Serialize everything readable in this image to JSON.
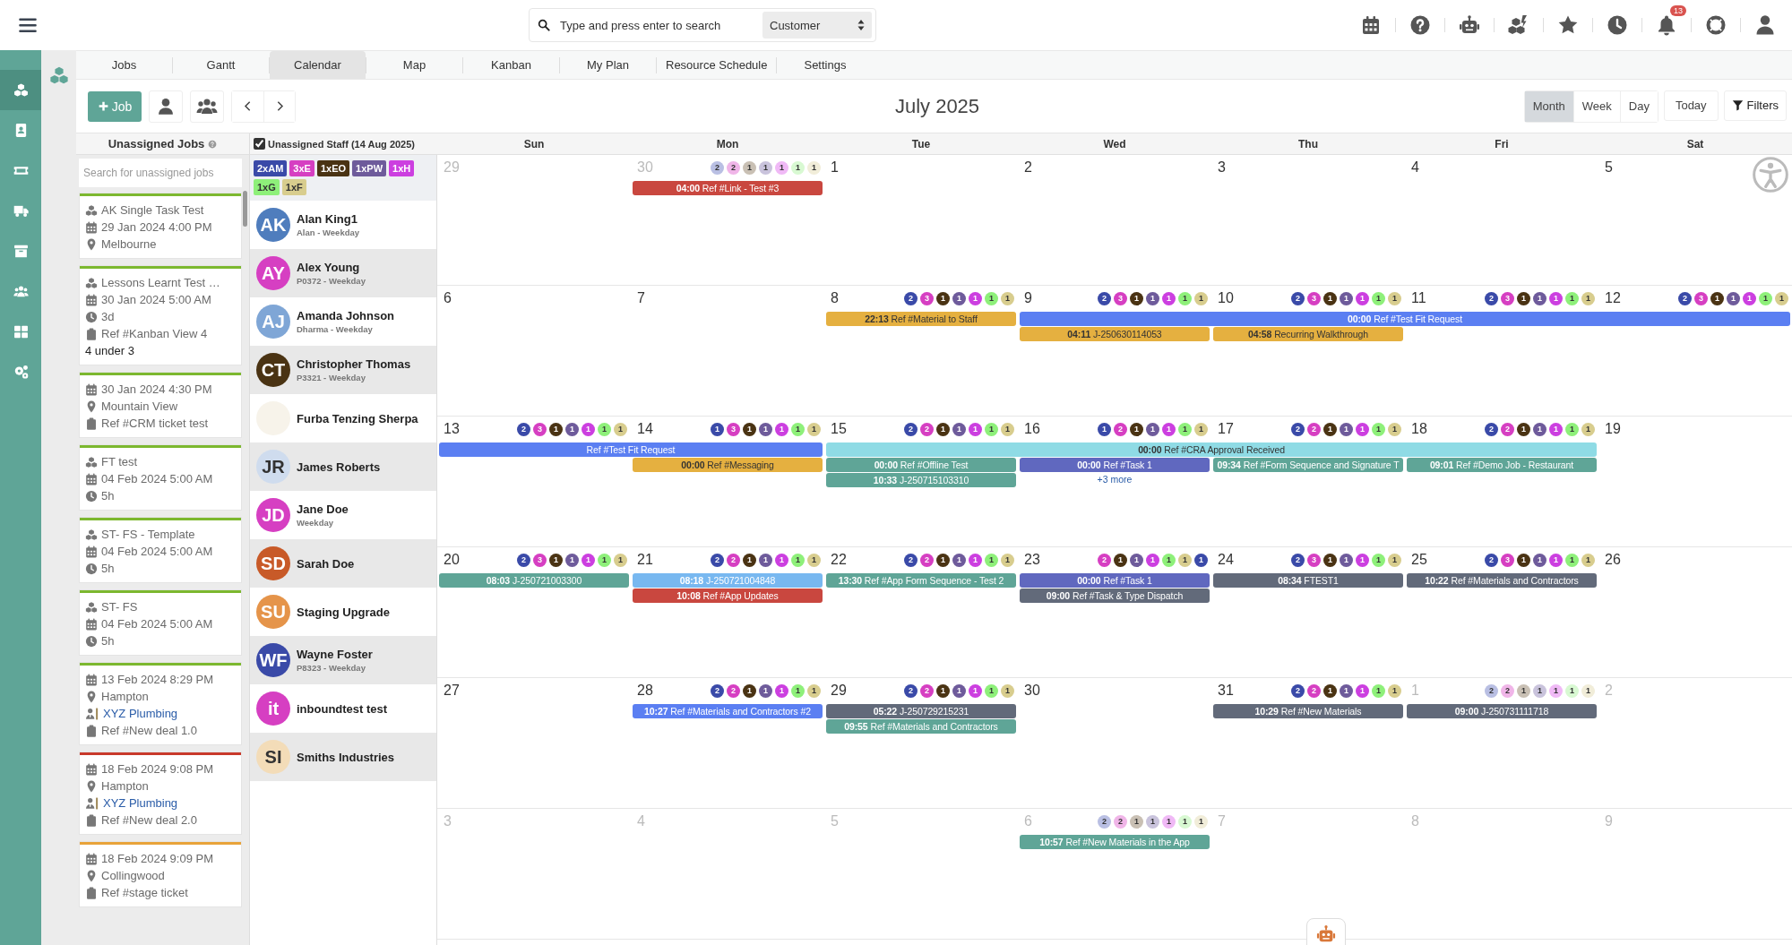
{
  "topbar": {
    "search": {
      "placeholder": "Type and press enter to search"
    },
    "search_scope": "Customer",
    "notification_count": "13"
  },
  "sidebar": [
    {
      "selected": true
    },
    {
      "selected": false
    },
    {
      "selected": false
    },
    {
      "selected": false
    },
    {
      "selected": false
    },
    {
      "selected": false
    },
    {
      "selected": false
    },
    {
      "selected": false
    }
  ],
  "tabs": [
    {
      "label": "Jobs",
      "selected": false
    },
    {
      "label": "Gantt",
      "selected": false
    },
    {
      "label": "Calendar",
      "selected": true
    },
    {
      "label": "Map",
      "selected": false
    },
    {
      "label": "Kanban",
      "selected": false
    },
    {
      "label": "My Plan",
      "selected": false
    },
    {
      "label": "Resource Schedule",
      "selected": false
    },
    {
      "label": "Settings",
      "selected": false
    }
  ],
  "toolbar": {
    "add_job": "Job",
    "title": "July 2025",
    "views": [
      {
        "label": "Month",
        "selected": true
      },
      {
        "label": "Week",
        "selected": false
      },
      {
        "label": "Day",
        "selected": false
      }
    ],
    "today": "Today",
    "filters": "Filters"
  },
  "unassigned_jobs": {
    "title": "Unassigned Jobs",
    "search": {
      "placeholder": "Search for unassigned jobs"
    },
    "jobs": [
      {
        "color": "#7cb82f",
        "lines": [
          {
            "kind": "task",
            "text": "AK Single Task Test"
          },
          {
            "kind": "date",
            "text": "29 Jan 2024 4:00 PM"
          },
          {
            "kind": "location",
            "text": "Melbourne"
          }
        ]
      },
      {
        "color": "#7cb82f",
        "lines": [
          {
            "kind": "task",
            "text": "Lessons Learnt Test …"
          },
          {
            "kind": "date",
            "text": "30 Jan 2024 5:00 AM"
          },
          {
            "kind": "duration",
            "text": "3d"
          },
          {
            "kind": "ref",
            "text": "Ref #Kanban View 4"
          },
          {
            "kind": "note",
            "text": "4 under 3"
          }
        ]
      },
      {
        "color": "#7cb82f",
        "lines": [
          {
            "kind": "date",
            "text": "30 Jan 2024 4:30 PM"
          },
          {
            "kind": "location",
            "text": "Mountain View"
          },
          {
            "kind": "ref",
            "text": "Ref #CRM ticket test"
          }
        ]
      },
      {
        "color": "#7cb82f",
        "lines": [
          {
            "kind": "task",
            "text": "FT test"
          },
          {
            "kind": "date",
            "text": "04 Feb 2024 5:00 AM"
          },
          {
            "kind": "duration",
            "text": "5h"
          }
        ]
      },
      {
        "color": "#7cb82f",
        "lines": [
          {
            "kind": "task",
            "text": "ST- FS - Template"
          },
          {
            "kind": "date",
            "text": "04 Feb 2024 5:00 AM"
          },
          {
            "kind": "duration",
            "text": "5h"
          }
        ]
      },
      {
        "color": "#7cb82f",
        "lines": [
          {
            "kind": "task",
            "text": "ST- FS"
          },
          {
            "kind": "date",
            "text": "04 Feb 2024 5:00 AM"
          },
          {
            "kind": "duration",
            "text": "5h"
          }
        ]
      },
      {
        "color": "#7cb82f",
        "lines": [
          {
            "kind": "date",
            "text": "13 Feb 2024 8:29 PM"
          },
          {
            "kind": "location",
            "text": "Hampton"
          },
          {
            "kind": "customer",
            "text": "XYZ Plumbing"
          },
          {
            "kind": "ref",
            "text": "Ref #New deal 1.0"
          }
        ]
      },
      {
        "color": "#c8392b",
        "lines": [
          {
            "kind": "date",
            "text": "18 Feb 2024 9:08 PM"
          },
          {
            "kind": "location",
            "text": "Hampton"
          },
          {
            "kind": "customer",
            "text": "XYZ Plumbing"
          },
          {
            "kind": "ref",
            "text": "Ref #New deal 2.0"
          }
        ]
      },
      {
        "color": "#e8a33a",
        "lines": [
          {
            "kind": "date",
            "text": "18 Feb 2024 9:09 PM"
          },
          {
            "kind": "location",
            "text": "Collingwood"
          },
          {
            "kind": "ref",
            "text": "Ref #stage ticket"
          }
        ]
      }
    ]
  },
  "staff": {
    "show_unassigned": true,
    "title": "Unassigned Staff (14 Aug 2025)",
    "tags": [
      {
        "label": "2xAM",
        "color": "#3a4aa8"
      },
      {
        "label": "3xE",
        "color": "#d63fc2"
      },
      {
        "label": "1xEO",
        "color": "#4a3313"
      },
      {
        "label": "1xPW",
        "color": "#6e5b9b"
      },
      {
        "label": "1xH",
        "color": "#cc3fe0"
      },
      {
        "label": "1xG",
        "color": "#8ef07a"
      },
      {
        "label": "1xF",
        "color": "#d8cd8e"
      }
    ],
    "members": [
      {
        "initials": "AK",
        "name": "Alan King1",
        "subtitle": "Alan - Weekday",
        "color": "#4f7dbd"
      },
      {
        "initials": "AY",
        "name": "Alex Young",
        "subtitle": "P0372 - Weekday",
        "color": "#d63fc2"
      },
      {
        "initials": "AJ",
        "name": "Amanda Johnson",
        "subtitle": "Dharma - Weekday",
        "color": "#7fa6d6"
      },
      {
        "initials": "CT",
        "name": "Christopher Thomas",
        "subtitle": "P3321 - Weekday",
        "color": "#4a3313"
      },
      {
        "name": "Furba Tenzing Sherpa",
        "color": "#f7f3ea"
      },
      {
        "initials": "JR",
        "name": "James Roberts",
        "color": "#cfdcee"
      },
      {
        "initials": "JD",
        "name": "Jane Doe",
        "subtitle": "Weekday",
        "color": "#d63fc2"
      },
      {
        "initials": "SD",
        "name": "Sarah Doe",
        "color": "#c85a28"
      },
      {
        "initials": "SU",
        "name": "Staging Upgrade",
        "color": "#e5944a"
      },
      {
        "initials": "WF",
        "name": "Wayne Foster",
        "subtitle": "P8323 - Weekday",
        "color": "#3a4aa8"
      },
      {
        "initials": "it",
        "name": "inboundtest test",
        "color": "#d63fc2"
      },
      {
        "initials": "SI",
        "name": "Smiths Industries",
        "color": "#f3dcb8"
      }
    ]
  },
  "calendar": {
    "weekdays": [
      "Sun",
      "Mon",
      "Tue",
      "Wed",
      "Thu",
      "Fri",
      "Sat"
    ],
    "weeks": [
      {
        "days": [
          {
            "number": "29",
            "muted": true
          },
          {
            "number": "30",
            "muted": true,
            "badges": [
              {
                "count": "2",
                "color": "#b9bfe3"
              },
              {
                "count": "2",
                "color": "#f0b5e8"
              },
              {
                "count": "1",
                "color": "#c9c0b4"
              },
              {
                "count": "1",
                "color": "#c9c3dc"
              },
              {
                "count": "1",
                "color": "#f0b9f6"
              },
              {
                "count": "1",
                "color": "#d8f9d2"
              },
              {
                "count": "1",
                "color": "#f1edd9"
              }
            ],
            "events": [
              {
                "kind": "event",
                "time": "04:00",
                "title": "Ref #Link - Test #3",
                "color": "#c9473f"
              }
            ]
          },
          {
            "number": "1",
            "muted": false
          },
          {
            "number": "2",
            "muted": false
          },
          {
            "number": "3",
            "muted": false
          },
          {
            "number": "4",
            "muted": false
          },
          {
            "number": "5",
            "muted": false
          }
        ]
      },
      {
        "days": [
          {
            "number": "6",
            "muted": false
          },
          {
            "number": "7",
            "muted": false
          },
          {
            "number": "8",
            "muted": false,
            "badges": [
              {
                "count": "2",
                "color": "#3a4aa8"
              },
              {
                "count": "3",
                "color": "#d63fc2"
              },
              {
                "count": "1",
                "color": "#4a3313"
              },
              {
                "count": "1",
                "color": "#6e5b9b"
              },
              {
                "count": "1",
                "color": "#cc3fe0"
              },
              {
                "count": "1",
                "color": "#8ef07a"
              },
              {
                "count": "1",
                "color": "#d8cd8e"
              }
            ],
            "events": [
              {
                "kind": "event",
                "time": "22:13",
                "title": "Ref #Material to Staff",
                "color": "#e5b040"
              }
            ]
          },
          {
            "number": "9",
            "muted": false,
            "badges": [
              {
                "count": "2",
                "color": "#3a4aa8"
              },
              {
                "count": "3",
                "color": "#d63fc2"
              },
              {
                "count": "1",
                "color": "#4a3313"
              },
              {
                "count": "1",
                "color": "#6e5b9b"
              },
              {
                "count": "1",
                "color": "#cc3fe0"
              },
              {
                "count": "1",
                "color": "#8ef07a"
              },
              {
                "count": "1",
                "color": "#d8cd8e"
              }
            ],
            "events": [
              {
                "kind": "event",
                "time": "00:00",
                "title": "Ref #Test Fit Request",
                "color": "#5b7ff2"
              },
              {
                "kind": "event",
                "time": "04:11",
                "title": "J-250630114053",
                "color": "#e5b040"
              }
            ]
          },
          {
            "number": "10",
            "muted": false,
            "badges": [
              {
                "count": "2",
                "color": "#3a4aa8"
              },
              {
                "count": "3",
                "color": "#d63fc2"
              },
              {
                "count": "1",
                "color": "#4a3313"
              },
              {
                "count": "1",
                "color": "#6e5b9b"
              },
              {
                "count": "1",
                "color": "#cc3fe0"
              },
              {
                "count": "1",
                "color": "#8ef07a"
              },
              {
                "count": "1",
                "color": "#d8cd8e"
              }
            ],
            "events": [
              {
                "kind": "continuation"
              },
              {
                "kind": "event",
                "time": "04:58",
                "title": "Recurring Walkthrough",
                "color": "#e5b040"
              }
            ]
          },
          {
            "number": "11",
            "muted": false,
            "badges": [
              {
                "count": "2",
                "color": "#3a4aa8"
              },
              {
                "count": "3",
                "color": "#d63fc2"
              },
              {
                "count": "1",
                "color": "#4a3313"
              },
              {
                "count": "1",
                "color": "#6e5b9b"
              },
              {
                "count": "1",
                "color": "#cc3fe0"
              },
              {
                "count": "1",
                "color": "#8ef07a"
              },
              {
                "count": "1",
                "color": "#d8cd8e"
              }
            ],
            "events": [
              {
                "kind": "continuation"
              }
            ]
          },
          {
            "number": "12",
            "muted": false,
            "badges": [
              {
                "count": "2",
                "color": "#3a4aa8"
              },
              {
                "count": "3",
                "color": "#d63fc2"
              },
              {
                "count": "1",
                "color": "#4a3313"
              },
              {
                "count": "1",
                "color": "#6e5b9b"
              },
              {
                "count": "1",
                "color": "#cc3fe0"
              },
              {
                "count": "1",
                "color": "#8ef07a"
              },
              {
                "count": "1",
                "color": "#d8cd8e"
              }
            ],
            "events": [
              {
                "kind": "continuation"
              }
            ]
          }
        ]
      },
      {
        "days": [
          {
            "number": "13",
            "muted": false,
            "badges": [
              {
                "count": "2",
                "color": "#3a4aa8"
              },
              {
                "count": "3",
                "color": "#d63fc2"
              },
              {
                "count": "1",
                "color": "#4a3313"
              },
              {
                "count": "1",
                "color": "#6e5b9b"
              },
              {
                "count": "1",
                "color": "#cc3fe0"
              },
              {
                "count": "1",
                "color": "#8ef07a"
              },
              {
                "count": "1",
                "color": "#d8cd8e"
              }
            ],
            "events": [
              {
                "kind": "event",
                "title": "Ref #Test Fit Request",
                "color": "#5b7ff2"
              }
            ]
          },
          {
            "number": "14",
            "muted": false,
            "badges": [
              {
                "count": "1",
                "color": "#3a4aa8"
              },
              {
                "count": "3",
                "color": "#d63fc2"
              },
              {
                "count": "1",
                "color": "#4a3313"
              },
              {
                "count": "1",
                "color": "#6e5b9b"
              },
              {
                "count": "1",
                "color": "#cc3fe0"
              },
              {
                "count": "1",
                "color": "#8ef07a"
              },
              {
                "count": "1",
                "color": "#d8cd8e"
              }
            ],
            "events": [
              {
                "kind": "continuation"
              },
              {
                "kind": "event",
                "time": "00:00",
                "title": "Ref #Messaging",
                "color": "#e5b040"
              }
            ]
          },
          {
            "number": "15",
            "muted": false,
            "badges": [
              {
                "count": "2",
                "color": "#3a4aa8"
              },
              {
                "count": "2",
                "color": "#d63fc2"
              },
              {
                "count": "1",
                "color": "#4a3313"
              },
              {
                "count": "1",
                "color": "#6e5b9b"
              },
              {
                "count": "1",
                "color": "#cc3fe0"
              },
              {
                "count": "1",
                "color": "#8ef07a"
              },
              {
                "count": "1",
                "color": "#d8cd8e"
              }
            ],
            "events": [
              {
                "kind": "event",
                "time": "00:00",
                "title": "Ref #CRA Approval Received",
                "color": "#8fdbe5"
              },
              {
                "kind": "event",
                "time": "00:00",
                "title": "Ref #Offline Test",
                "color": "#5fa597"
              },
              {
                "kind": "event",
                "time": "10:33",
                "title": "J-250715103310",
                "color": "#5fa597"
              }
            ]
          },
          {
            "number": "16",
            "muted": false,
            "badges": [
              {
                "count": "1",
                "color": "#3a4aa8"
              },
              {
                "count": "2",
                "color": "#d63fc2"
              },
              {
                "count": "1",
                "color": "#4a3313"
              },
              {
                "count": "1",
                "color": "#6e5b9b"
              },
              {
                "count": "1",
                "color": "#cc3fe0"
              },
              {
                "count": "1",
                "color": "#8ef07a"
              },
              {
                "count": "1",
                "color": "#d8cd8e"
              }
            ],
            "events": [
              {
                "kind": "continuation"
              },
              {
                "kind": "event",
                "time": "00:00",
                "title": "Ref #Task 1",
                "color": "#6068bf"
              },
              {
                "kind": "more",
                "title": "+3 more"
              }
            ]
          },
          {
            "number": "17",
            "muted": false,
            "badges": [
              {
                "count": "2",
                "color": "#3a4aa8"
              },
              {
                "count": "2",
                "color": "#d63fc2"
              },
              {
                "count": "1",
                "color": "#4a3313"
              },
              {
                "count": "1",
                "color": "#6e5b9b"
              },
              {
                "count": "1",
                "color": "#cc3fe0"
              },
              {
                "count": "1",
                "color": "#8ef07a"
              },
              {
                "count": "1",
                "color": "#d8cd8e"
              }
            ],
            "events": [
              {
                "kind": "continuation"
              },
              {
                "kind": "event",
                "time": "09:34",
                "title": "Ref #Form Sequence and Signature T",
                "color": "#5fa597"
              }
            ]
          },
          {
            "number": "18",
            "muted": false,
            "badges": [
              {
                "count": "2",
                "color": "#3a4aa8"
              },
              {
                "count": "2",
                "color": "#d63fc2"
              },
              {
                "count": "1",
                "color": "#4a3313"
              },
              {
                "count": "1",
                "color": "#6e5b9b"
              },
              {
                "count": "1",
                "color": "#cc3fe0"
              },
              {
                "count": "1",
                "color": "#8ef07a"
              },
              {
                "count": "1",
                "color": "#d8cd8e"
              }
            ],
            "events": [
              {
                "kind": "continuation"
              },
              {
                "kind": "event",
                "time": "09:01",
                "title": "Ref #Demo Job - Restaurant",
                "color": "#5fa597"
              }
            ]
          },
          {
            "number": "19",
            "muted": false
          }
        ]
      },
      {
        "days": [
          {
            "number": "20",
            "muted": false,
            "badges": [
              {
                "count": "2",
                "color": "#3a4aa8"
              },
              {
                "count": "3",
                "color": "#d63fc2"
              },
              {
                "count": "1",
                "color": "#4a3313"
              },
              {
                "count": "1",
                "color": "#6e5b9b"
              },
              {
                "count": "1",
                "color": "#cc3fe0"
              },
              {
                "count": "1",
                "color": "#8ef07a"
              },
              {
                "count": "1",
                "color": "#d8cd8e"
              }
            ],
            "events": [
              {
                "kind": "event",
                "time": "08:03",
                "title": "J-250721003300",
                "color": "#5fa597"
              }
            ]
          },
          {
            "number": "21",
            "muted": false,
            "badges": [
              {
                "count": "2",
                "color": "#3a4aa8"
              },
              {
                "count": "2",
                "color": "#d63fc2"
              },
              {
                "count": "1",
                "color": "#4a3313"
              },
              {
                "count": "1",
                "color": "#6e5b9b"
              },
              {
                "count": "1",
                "color": "#cc3fe0"
              },
              {
                "count": "1",
                "color": "#8ef07a"
              },
              {
                "count": "1",
                "color": "#d8cd8e"
              }
            ],
            "events": [
              {
                "kind": "event",
                "time": "08:18",
                "title": "J-250721004848",
                "color": "#78b8f0"
              },
              {
                "kind": "event",
                "time": "10:08",
                "title": "Ref #App Updates",
                "color": "#c9473f"
              }
            ]
          },
          {
            "number": "22",
            "muted": false,
            "badges": [
              {
                "count": "2",
                "color": "#3a4aa8"
              },
              {
                "count": "2",
                "color": "#d63fc2"
              },
              {
                "count": "1",
                "color": "#4a3313"
              },
              {
                "count": "1",
                "color": "#6e5b9b"
              },
              {
                "count": "1",
                "color": "#cc3fe0"
              },
              {
                "count": "1",
                "color": "#8ef07a"
              },
              {
                "count": "1",
                "color": "#d8cd8e"
              }
            ],
            "events": [
              {
                "kind": "event",
                "time": "13:30",
                "title": "Ref #App Form Sequence - Test 2",
                "color": "#5fa597"
              }
            ]
          },
          {
            "number": "23",
            "muted": false,
            "badges": [
              {
                "count": "2",
                "color": "#d63fc2"
              },
              {
                "count": "1",
                "color": "#4a3313"
              },
              {
                "count": "1",
                "color": "#6e5b9b"
              },
              {
                "count": "1",
                "color": "#cc3fe0"
              },
              {
                "count": "1",
                "color": "#8ef07a"
              },
              {
                "count": "1",
                "color": "#d8cd8e"
              },
              {
                "count": "1",
                "color": "#3a4aa8"
              }
            ],
            "events": [
              {
                "kind": "event",
                "time": "00:00",
                "title": "Ref #Task 1",
                "color": "#6068bf"
              },
              {
                "kind": "event",
                "time": "09:00",
                "title": "Ref #Task & Type Dispatch",
                "color": "#626a7a"
              }
            ]
          },
          {
            "number": "24",
            "muted": false,
            "badges": [
              {
                "count": "2",
                "color": "#3a4aa8"
              },
              {
                "count": "3",
                "color": "#d63fc2"
              },
              {
                "count": "1",
                "color": "#4a3313"
              },
              {
                "count": "1",
                "color": "#6e5b9b"
              },
              {
                "count": "1",
                "color": "#cc3fe0"
              },
              {
                "count": "1",
                "color": "#8ef07a"
              },
              {
                "count": "1",
                "color": "#d8cd8e"
              }
            ],
            "events": [
              {
                "kind": "event",
                "time": "08:34",
                "title": "FTEST1",
                "color": "#626a7a"
              }
            ]
          },
          {
            "number": "25",
            "muted": false,
            "badges": [
              {
                "count": "2",
                "color": "#3a4aa8"
              },
              {
                "count": "3",
                "color": "#d63fc2"
              },
              {
                "count": "1",
                "color": "#4a3313"
              },
              {
                "count": "1",
                "color": "#6e5b9b"
              },
              {
                "count": "1",
                "color": "#cc3fe0"
              },
              {
                "count": "1",
                "color": "#8ef07a"
              },
              {
                "count": "1",
                "color": "#d8cd8e"
              }
            ],
            "events": [
              {
                "kind": "event",
                "time": "10:22",
                "title": "Ref #Materials and Contractors",
                "color": "#626a7a"
              }
            ]
          },
          {
            "number": "26",
            "muted": false
          }
        ]
      },
      {
        "days": [
          {
            "number": "27",
            "muted": false
          },
          {
            "number": "28",
            "muted": false,
            "badges": [
              {
                "count": "2",
                "color": "#3a4aa8"
              },
              {
                "count": "2",
                "color": "#d63fc2"
              },
              {
                "count": "1",
                "color": "#4a3313"
              },
              {
                "count": "1",
                "color": "#6e5b9b"
              },
              {
                "count": "1",
                "color": "#cc3fe0"
              },
              {
                "count": "1",
                "color": "#8ef07a"
              },
              {
                "count": "1",
                "color": "#d8cd8e"
              }
            ],
            "events": [
              {
                "kind": "event",
                "time": "10:27",
                "title": "Ref #Materials and Contractors #2",
                "color": "#5b7ff2"
              }
            ]
          },
          {
            "number": "29",
            "muted": false,
            "badges": [
              {
                "count": "2",
                "color": "#3a4aa8"
              },
              {
                "count": "2",
                "color": "#d63fc2"
              },
              {
                "count": "1",
                "color": "#4a3313"
              },
              {
                "count": "1",
                "color": "#6e5b9b"
              },
              {
                "count": "1",
                "color": "#cc3fe0"
              },
              {
                "count": "1",
                "color": "#8ef07a"
              },
              {
                "count": "1",
                "color": "#d8cd8e"
              }
            ],
            "events": [
              {
                "kind": "event",
                "time": "05:22",
                "title": "J-250729215231",
                "color": "#626a7a"
              },
              {
                "kind": "event",
                "time": "09:55",
                "title": "Ref #Materials and Contractors",
                "color": "#5fa597"
              }
            ]
          },
          {
            "number": "30",
            "muted": false
          },
          {
            "number": "31",
            "muted": false,
            "badges": [
              {
                "count": "2",
                "color": "#3a4aa8"
              },
              {
                "count": "2",
                "color": "#d63fc2"
              },
              {
                "count": "1",
                "color": "#4a3313"
              },
              {
                "count": "1",
                "color": "#6e5b9b"
              },
              {
                "count": "1",
                "color": "#cc3fe0"
              },
              {
                "count": "1",
                "color": "#8ef07a"
              },
              {
                "count": "1",
                "color": "#d8cd8e"
              }
            ],
            "events": [
              {
                "kind": "event",
                "time": "10:29",
                "title": "Ref #New Materials",
                "color": "#626a7a"
              }
            ]
          },
          {
            "number": "1",
            "muted": true,
            "badges": [
              {
                "count": "2",
                "color": "#b9bfe3"
              },
              {
                "count": "2",
                "color": "#f0b5e8"
              },
              {
                "count": "1",
                "color": "#c9c0b4"
              },
              {
                "count": "1",
                "color": "#c9c3dc"
              },
              {
                "count": "1",
                "color": "#f0b9f6"
              },
              {
                "count": "1",
                "color": "#d8f9d2"
              },
              {
                "count": "1",
                "color": "#f1edd9"
              }
            ],
            "events": [
              {
                "kind": "event",
                "time": "09:00",
                "title": "J-250731111718",
                "color": "#626a7a"
              }
            ]
          },
          {
            "number": "2",
            "muted": true
          }
        ]
      },
      {
        "days": [
          {
            "number": "3",
            "muted": true
          },
          {
            "number": "4",
            "muted": true
          },
          {
            "number": "5",
            "muted": true
          },
          {
            "number": "6",
            "muted": true,
            "badges": [
              {
                "count": "2",
                "color": "#b9bfe3"
              },
              {
                "count": "2",
                "color": "#f0b5e8"
              },
              {
                "count": "1",
                "color": "#c9c0b4"
              },
              {
                "count": "1",
                "color": "#c9c3dc"
              },
              {
                "count": "1",
                "color": "#f0b9f6"
              },
              {
                "count": "1",
                "color": "#d8f9d2"
              },
              {
                "count": "1",
                "color": "#f1edd9"
              }
            ],
            "events": [
              {
                "kind": "event",
                "time": "10:57",
                "title": "Ref #New Materials in the App",
                "color": "#5fa597"
              }
            ]
          },
          {
            "number": "7",
            "muted": true
          },
          {
            "number": "8",
            "muted": true
          },
          {
            "number": "9",
            "muted": true
          }
        ]
      }
    ]
  }
}
